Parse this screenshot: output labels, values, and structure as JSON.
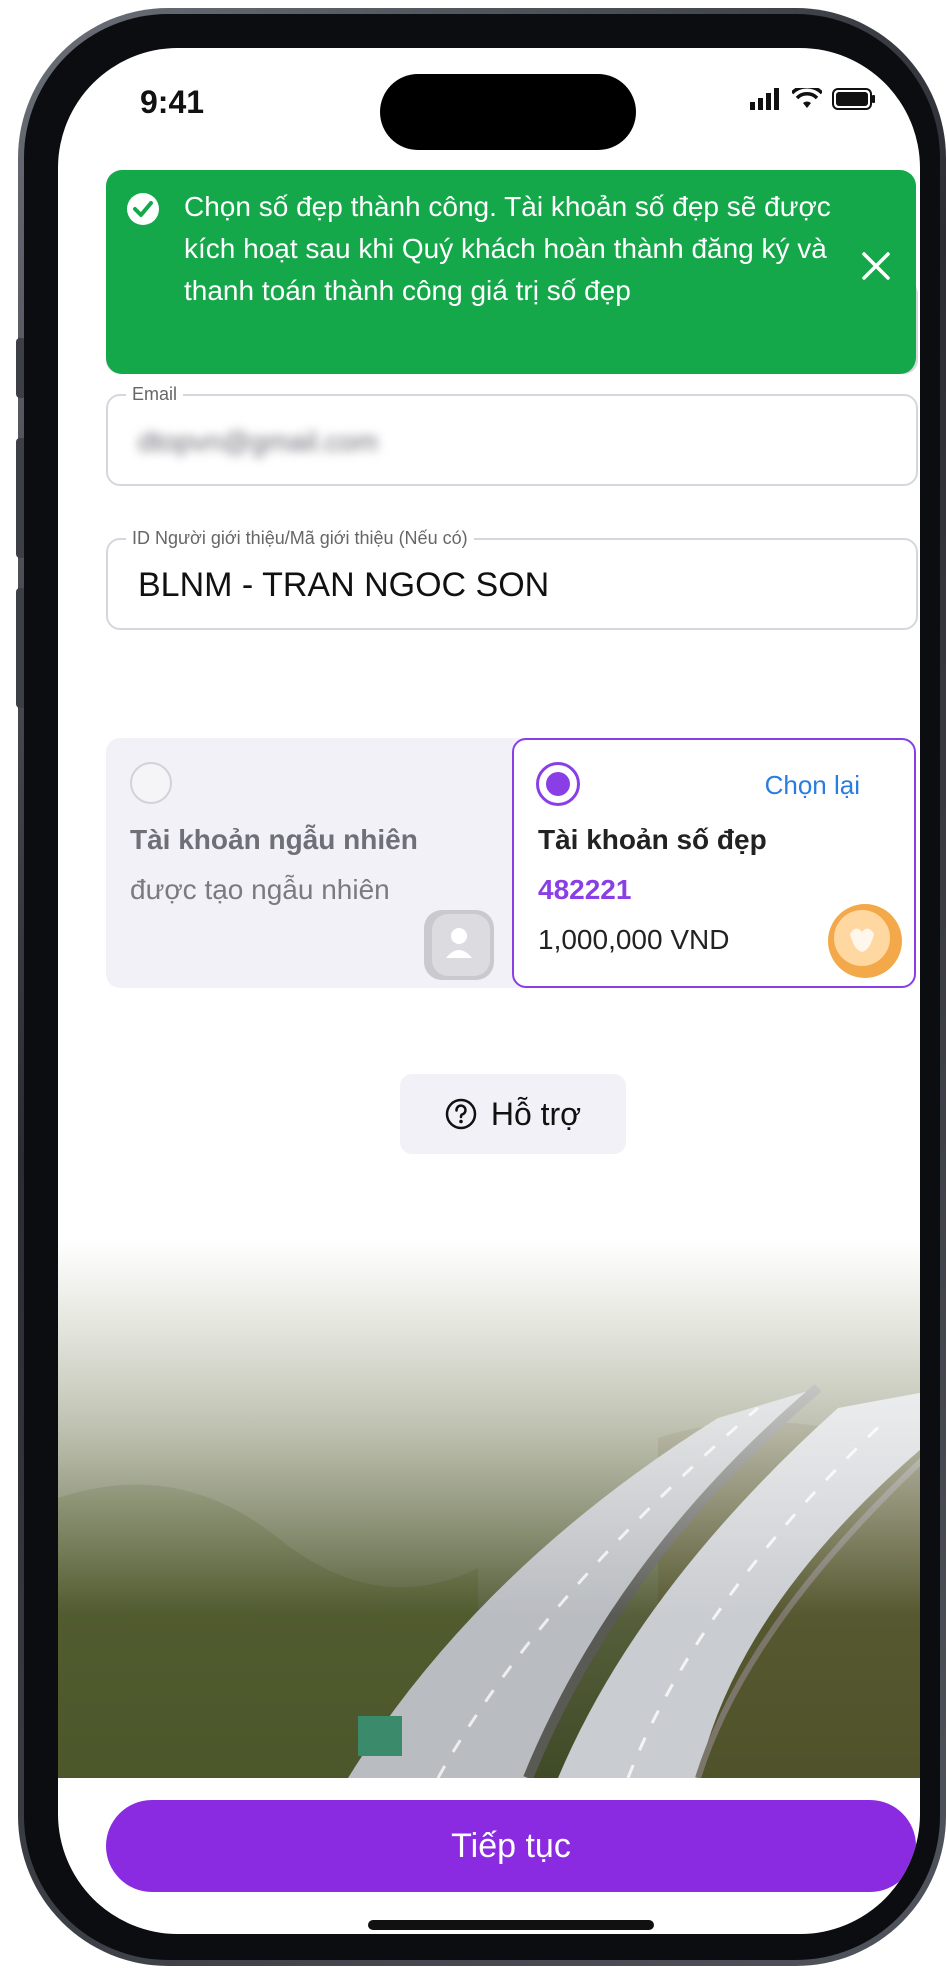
{
  "status_bar": {
    "time": "9:41"
  },
  "toast": {
    "message": "Chọn số đẹp thành công. Tài khoản số đẹp sẽ được kích hoạt sau khi Quý khách hoàn thành đăng ký và thanh toán thành công giá trị số đẹp",
    "color": "#15a84a"
  },
  "form": {
    "email_label": "Email",
    "email_value": "dtopvn@gmail.com",
    "referral_label": "ID Người giới thiệu/Mã giới thiệu (Nếu có)",
    "referral_value": "BLNM - TRAN NGOC SON"
  },
  "account_options": {
    "random": {
      "title": "Tài khoản ngẫu nhiên",
      "subtitle": "được tạo ngẫu nhiên",
      "selected": false
    },
    "beautiful": {
      "title": "Tài khoản số đẹp",
      "number": "482221",
      "price": "1,000,000 VND",
      "reselect_label": "Chọn lại",
      "selected": true
    }
  },
  "support": {
    "label": "Hỗ trợ",
    "icon": "question-circle-icon"
  },
  "actions": {
    "continue_label": "Tiếp tục"
  },
  "colors": {
    "primary": "#8a2be2",
    "accent_text": "#8a3fe6",
    "link": "#2a7de0",
    "success": "#15a84a"
  }
}
